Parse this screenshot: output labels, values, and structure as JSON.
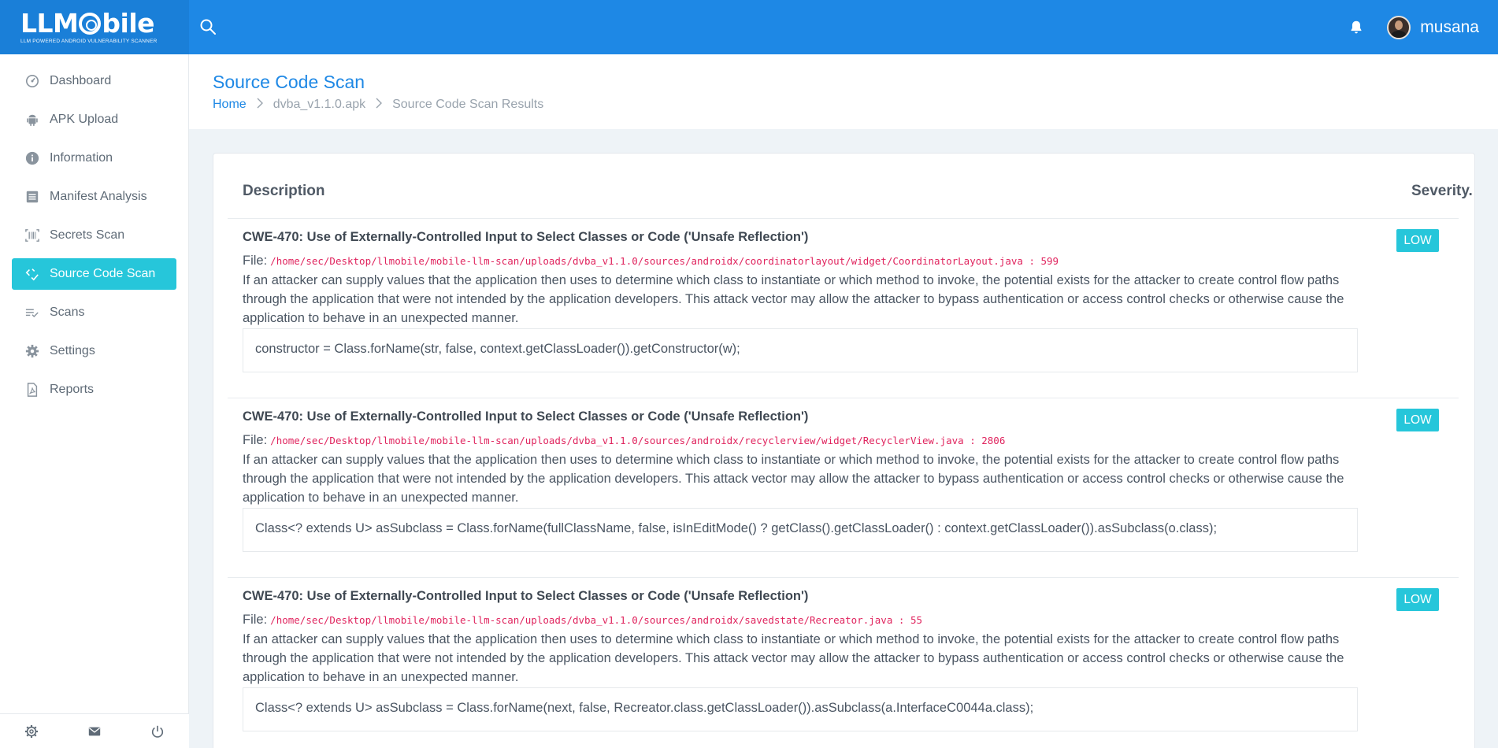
{
  "brand": {
    "name_part1": "LLM",
    "name_part2": "bile",
    "tagline": "LLM POWERED ANDROID VULNERABILITY SCANNER"
  },
  "user": {
    "name": "musana"
  },
  "sidebar": {
    "items": [
      {
        "label": "Dashboard",
        "icon": "dashboard-icon"
      },
      {
        "label": "APK Upload",
        "icon": "android-icon"
      },
      {
        "label": "Information",
        "icon": "info-icon"
      },
      {
        "label": "Manifest Analysis",
        "icon": "list-icon"
      },
      {
        "label": "Secrets Scan",
        "icon": "barcode-icon"
      },
      {
        "label": "Source Code Scan",
        "icon": "code-check-icon",
        "active": true
      },
      {
        "label": "Scans",
        "icon": "list-check-icon"
      },
      {
        "label": "Settings",
        "icon": "gear-icon"
      },
      {
        "label": "Reports",
        "icon": "pdf-icon"
      }
    ]
  },
  "page": {
    "title": "Source Code Scan",
    "breadcrumb": [
      "Home",
      "dvba_v1.1.0.apk",
      "Source Code Scan Results"
    ]
  },
  "table": {
    "headers": {
      "description": "Description",
      "severity": "Severity."
    },
    "rows": [
      {
        "title": "CWE-470: Use of Externally-Controlled Input to Select Classes or Code ('Unsafe Reflection')",
        "file_label": "File:",
        "file_path": "/home/sec/Desktop/llmobile/mobile-llm-scan/uploads/dvba_v1.1.0/sources/androidx/coordinatorlayout/widget/CoordinatorLayout.java : 599",
        "description": "If an attacker can supply values that the application then uses to determine which class to instantiate or which method to invoke, the potential exists for the attacker to create control flow paths through the application that were not intended by the application developers. This attack vector may allow the attacker to bypass authentication or access control checks or otherwise cause the application to behave in an unexpected manner.",
        "code": "constructor = Class.forName(str, false, context.getClassLoader()).getConstructor(w);",
        "severity": "LOW"
      },
      {
        "title": "CWE-470: Use of Externally-Controlled Input to Select Classes or Code ('Unsafe Reflection')",
        "file_label": "File:",
        "file_path": "/home/sec/Desktop/llmobile/mobile-llm-scan/uploads/dvba_v1.1.0/sources/androidx/recyclerview/widget/RecyclerView.java : 2806",
        "description": "If an attacker can supply values that the application then uses to determine which class to instantiate or which method to invoke, the potential exists for the attacker to create control flow paths through the application that were not intended by the application developers. This attack vector may allow the attacker to bypass authentication or access control checks or otherwise cause the application to behave in an unexpected manner.",
        "code": "Class<? extends U> asSubclass = Class.forName(fullClassName, false, isInEditMode() ? getClass().getClassLoader() : context.getClassLoader()).asSubclass(o.class);",
        "severity": "LOW"
      },
      {
        "title": "CWE-470: Use of Externally-Controlled Input to Select Classes or Code ('Unsafe Reflection')",
        "file_label": "File:",
        "file_path": "/home/sec/Desktop/llmobile/mobile-llm-scan/uploads/dvba_v1.1.0/sources/androidx/savedstate/Recreator.java : 55",
        "description": "If an attacker can supply values that the application then uses to determine which class to instantiate or which method to invoke, the potential exists for the attacker to create control flow paths through the application that were not intended by the application developers. This attack vector may allow the attacker to bypass authentication or access control checks or otherwise cause the application to behave in an unexpected manner.",
        "code": "Class<? extends U> asSubclass = Class.forName(next, false, Recreator.class.getClassLoader()).asSubclass(a.InterfaceC0044a.class);",
        "severity": "LOW"
      }
    ]
  },
  "footer_icons": [
    "gear-icon",
    "mail-icon",
    "power-icon"
  ],
  "colors": {
    "primary": "#1e88e5",
    "accent": "#26c6da",
    "file_path": "#e0245e"
  }
}
